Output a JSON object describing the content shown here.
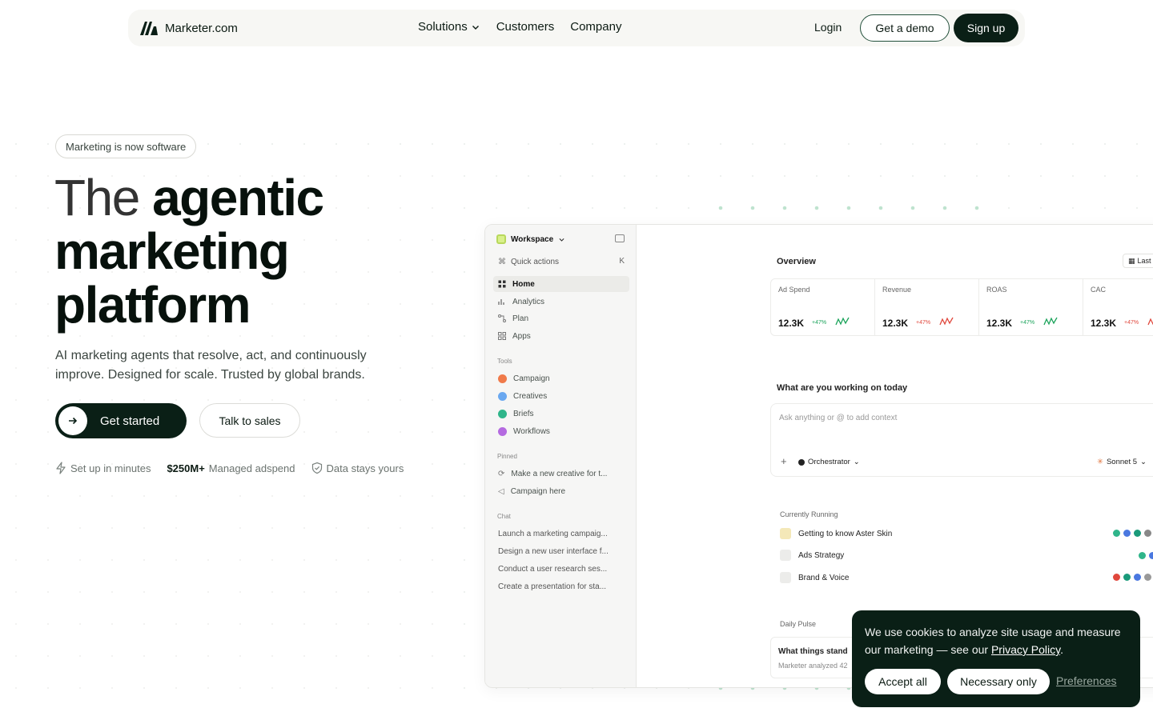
{
  "nav": {
    "brand": "Marketer.com",
    "links": [
      "Solutions",
      "Customers",
      "Company"
    ],
    "login": "Login",
    "demo": "Get a demo",
    "signup": "Sign up"
  },
  "hero": {
    "badge": "Marketing is now software",
    "headline_light": "The",
    "headline_bold_1": "agentic",
    "headline_bold_2": "marketing",
    "headline_bold_3": "platform",
    "subtitle": "AI marketing agents that resolve, act, and continuously improve. Designed for scale. Trusted by global brands.",
    "cta_primary": "Get started",
    "cta_secondary": "Talk to sales",
    "trust": {
      "setup": "Set up in minutes",
      "adspend_value": "$250M+",
      "adspend_label": "Managed adspend",
      "data": "Data stays yours"
    }
  },
  "app": {
    "workspace": "Workspace",
    "quick_actions": "Quick actions",
    "quick_key": "K",
    "nav": [
      "Home",
      "Analytics",
      "Plan",
      "Apps"
    ],
    "tools_heading": "Tools",
    "tools": [
      "Campaign",
      "Creatives",
      "Briefs",
      "Workflows"
    ],
    "pinned_heading": "Pinned",
    "pinned": [
      "Make a new creative for t...",
      "Campaign here"
    ],
    "chat_heading": "Chat",
    "chats": [
      "Launch a marketing campaig...",
      "Design a new user interface f...",
      "Conduct a user research ses...",
      "Create a presentation for sta..."
    ],
    "overview": "Overview",
    "last": "Last",
    "stats": [
      {
        "title": "Ad Spend",
        "value": "12.3K",
        "change": "+47%",
        "color": "#1aa35a"
      },
      {
        "title": "Revenue",
        "value": "12.3K",
        "change": "+47%",
        "color": "#e0473c"
      },
      {
        "title": "ROAS",
        "value": "12.3K",
        "change": "+47%",
        "color": "#1aa35a"
      },
      {
        "title": "CAC",
        "value": "12.3K",
        "change": "+47%",
        "color": "#e0473c"
      }
    ],
    "working_title": "What are you working on today",
    "prompt_placeholder": "Ask anything or @ to add context",
    "plus": "+",
    "orchestrator": "Orchestrator",
    "model": "Sonnet 5",
    "running_title": "Currently Running",
    "running": [
      "Getting to know Aster Skin",
      "Ads Strategy",
      "Brand & Voice"
    ],
    "pulse_title": "Daily Pulse",
    "pulse_card_title": "What things stand",
    "pulse_card_text": "Marketer analyzed 42"
  },
  "cookie": {
    "message": "We use cookies to analyze site usage and measure our marketing — see our",
    "link": "Privacy Policy",
    "period": ".",
    "accept": "Accept all",
    "necessary": "Necessary only",
    "preferences": "Preferences"
  },
  "colors": {
    "brand_dark": "#0a1f16",
    "accent_green": "#1aa35a",
    "negative_red": "#e0473c"
  }
}
